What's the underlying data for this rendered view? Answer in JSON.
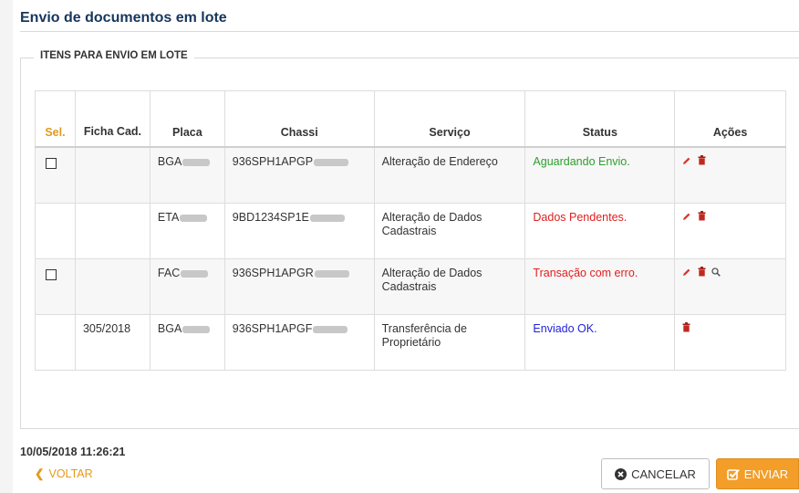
{
  "page": {
    "title": "Envio de documentos em lote",
    "section_title": "ITENS PARA ENVIO EM LOTE",
    "timestamp": "10/05/2018 11:26:21"
  },
  "table": {
    "headers": {
      "sel": "Sel.",
      "ficha": "Ficha Cad.",
      "placa": "Placa",
      "chassi": "Chassi",
      "servico": "Serviço",
      "status": "Status",
      "acoes": "Ações"
    },
    "rows": [
      {
        "ficha": "",
        "placa": "BGA",
        "chassi": "936SPH1APGP",
        "servico": "Alteração de Endereço",
        "status": "Aguardando Envio.",
        "status_color": "#2e9e2e"
      },
      {
        "ficha": "",
        "placa": "ETA",
        "chassi": "9BD1234SP1E",
        "servico": "Alteração de Dados Cadastrais",
        "status": "Dados Pendentes.",
        "status_color": "#e02020"
      },
      {
        "ficha": "",
        "placa": "FAC",
        "chassi": "936SPH1APGR",
        "servico": "Alteração de Dados Cadastrais",
        "status": "Transação com erro.",
        "status_color": "#e02020"
      },
      {
        "ficha": "305/2018",
        "placa": "BGA",
        "chassi": "936SPH1APGF",
        "servico": "Transferência de Proprietário",
        "status": "Enviado OK.",
        "status_color": "#2222dd"
      }
    ]
  },
  "actions": {
    "voltar_label": "VOLTAR",
    "cancel_label": "CANCELAR",
    "send_label": "ENVIAR"
  },
  "colors": {
    "title": "#17365d",
    "accent": "#f29e29"
  }
}
